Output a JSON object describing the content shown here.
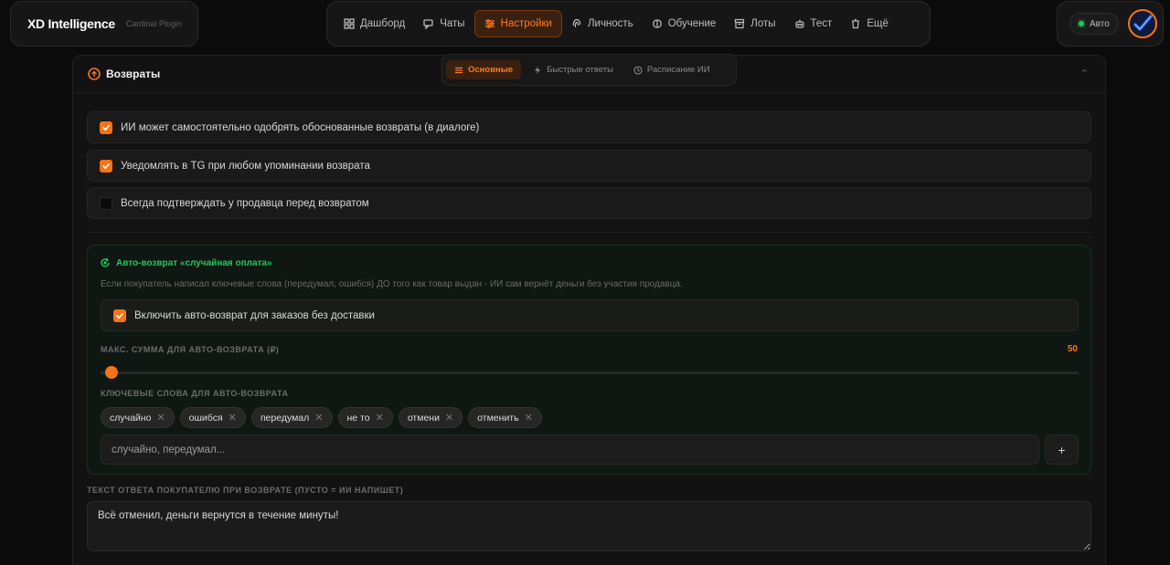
{
  "brand": {
    "name": "XD Intelligence",
    "subtitle": "Cardinal Plugin"
  },
  "nav": {
    "items": [
      {
        "label": "Дашборд",
        "icon": "dashboard-icon"
      },
      {
        "label": "Чаты",
        "icon": "chat-icon"
      },
      {
        "label": "Настройки",
        "icon": "settings-sliders-icon",
        "active": true
      },
      {
        "label": "Личность",
        "icon": "fingerprint-icon"
      },
      {
        "label": "Обучение",
        "icon": "brain-icon"
      },
      {
        "label": "Лоты",
        "icon": "box-icon"
      },
      {
        "label": "Тест",
        "icon": "robot-icon"
      },
      {
        "label": "Ещё",
        "icon": "trash-icon"
      }
    ]
  },
  "user": {
    "auto_label": "Авто",
    "status_color": "#22c55e"
  },
  "panel": {
    "title": "Возвраты",
    "tabs": [
      {
        "label": "Основные",
        "icon": "sliders-icon",
        "active": true
      },
      {
        "label": "Быстрые ответы",
        "icon": "lightning-icon"
      },
      {
        "label": "Расписание ИИ",
        "icon": "clock-icon"
      }
    ],
    "options": [
      {
        "label": "ИИ может самостоятельно одобрять обоснованные возвраты (в диалоге)",
        "checked": true
      },
      {
        "label": "Уведомлять в TG при любом упоминании возврата",
        "checked": true
      },
      {
        "label": "Всегда подтверждать у продавца перед возвратом",
        "checked": false
      }
    ]
  },
  "auto_refund": {
    "title": "Авто-возврат «случайная оплата»",
    "description": "Если покупатель написал ключевые слова (передумал, ошибся) ДО того как товар выдан - ИИ сам вернёт деньги без участия продавца.",
    "enable_label": "Включить авто-возврат для заказов без доставки",
    "enable_checked": true,
    "max_label": "Макс. сумма для авто-возврата (₽)",
    "max_value": "50",
    "slider_fraction": 0.011,
    "keywords_label": "Ключевые слова для авто-возврата",
    "keywords": [
      "случайно",
      "ошибся",
      "передумал",
      "не то",
      "отмени",
      "отменить"
    ],
    "keyword_placeholder": "случайно, передумал...",
    "add_button": "+"
  },
  "reply": {
    "label": "Текст ответа покупателю при возврате (пусто = ИИ напишет)",
    "value": "Всё отменил, деньги вернутся в течение минуты!"
  },
  "colors": {
    "accent": "#f97316",
    "success": "#22c55e",
    "background": "#0b0b0b"
  }
}
